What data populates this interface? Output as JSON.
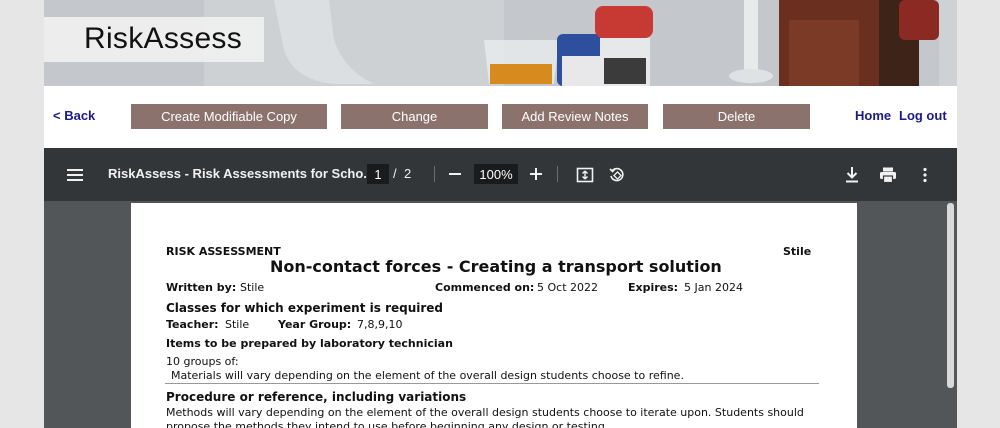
{
  "banner": {
    "logo": "RiskAssess"
  },
  "nav": {
    "back": "< Back",
    "buttons": [
      "Create Modifiable Copy",
      "Change",
      "Add Review Notes",
      "Delete"
    ],
    "home": "Home",
    "logout": "Log out"
  },
  "viewer": {
    "title": "RiskAssess - Risk Assessments for Scho...",
    "page_current": "1",
    "page_sep": "/",
    "page_total": "2",
    "zoom": "100%",
    "icons": [
      "menu-icon",
      "zoom-out-icon",
      "zoom-in-icon",
      "fit-page-icon",
      "rotate-icon",
      "download-icon",
      "print-icon",
      "more-icon"
    ]
  },
  "document": {
    "header_left": "RISK ASSESSMENT",
    "header_right": "Stile",
    "title": "Non-contact forces - Creating a transport solution",
    "written_by_label": "Written by:",
    "written_by": "Stile",
    "commenced_label": "Commenced on:",
    "commenced": "5 Oct 2022",
    "expires_label": "Expires:",
    "expires": "5 Jan 2024",
    "classes_heading": "Classes for which experiment is required",
    "teacher_label": "Teacher:",
    "teacher": "Stile",
    "year_label": "Year Group:",
    "year": "7,8,9,10",
    "items_heading": "Items to be prepared by laboratory technician",
    "groups": "10 groups of:",
    "materials": "Materials will vary depending on the element of the overall design students choose to refine.",
    "procedure_heading": "Procedure or reference, including variations",
    "procedure_line1": "Methods will vary depending on the element of the overall design students choose to iterate upon. Students should",
    "procedure_line2": "propose the methods they intend to use before beginning any design or testing."
  },
  "colors": {
    "button_bg": "#8c726d",
    "link": "#1a1a8a",
    "toolbar": "#323639",
    "viewer_bg": "#525659"
  }
}
